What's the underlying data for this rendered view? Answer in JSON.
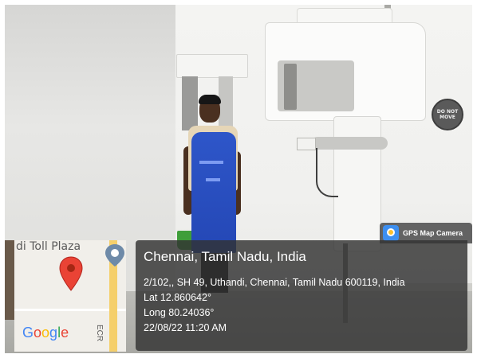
{
  "sign": {
    "line1": "DO NOT",
    "line2": "MOVE"
  },
  "map": {
    "place_label": "di Toll Plaza",
    "road_label": "ECR",
    "logo_text": "Google"
  },
  "badge": {
    "app_name": "GPS Map Camera",
    "icon": "gps-map-camera-icon"
  },
  "location": {
    "title": "Chennai, Tamil Nadu, India",
    "address": "2/102,, SH 49, Uthandi, Chennai, Tamil Nadu 600119, India",
    "latitude": "Lat 12.860642°",
    "longitude": "Long 80.24036°",
    "timestamp": "22/08/22 11:20 AM"
  },
  "colors": {
    "apron": "#2447b5",
    "pin": "#ea4335",
    "road": "#f5cf6b",
    "panel": "#323232"
  }
}
